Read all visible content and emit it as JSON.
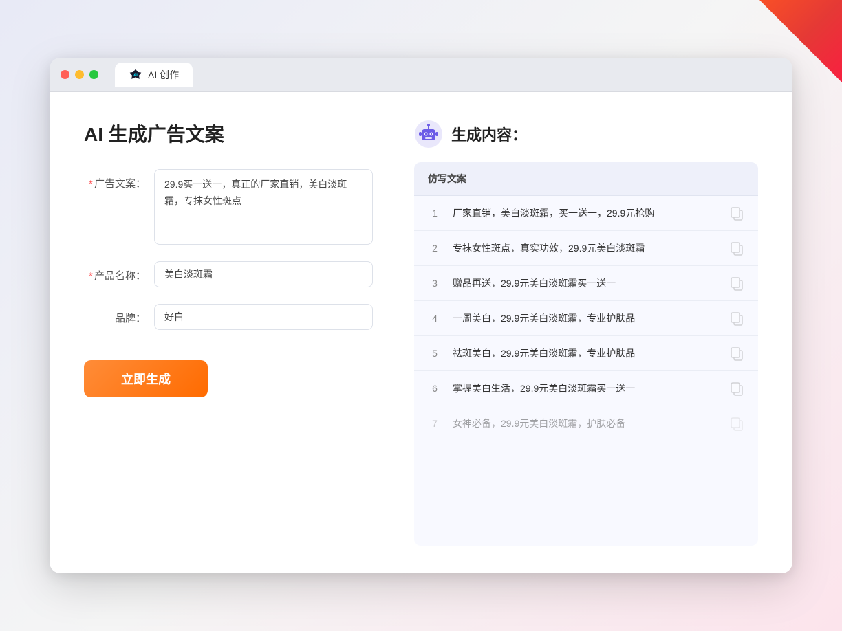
{
  "window": {
    "tab_title": "AI 创作"
  },
  "page": {
    "title": "AI 生成广告文案",
    "form": {
      "ad_copy_label": "广告文案：",
      "ad_copy_required": "*",
      "ad_copy_value": "29.9买一送一，真正的厂家直销，美白淡斑霜，专抹女性斑点",
      "product_name_label": "产品名称：",
      "product_name_required": "*",
      "product_name_value": "美白淡斑霜",
      "brand_label": "品牌：",
      "brand_value": "好白",
      "generate_btn_label": "立即生成"
    },
    "result": {
      "header_icon": "robot",
      "header_title": "生成内容：",
      "table_header": "仿写文案",
      "items": [
        {
          "num": "1",
          "text": "厂家直销，美白淡斑霜，买一送一，29.9元抢购"
        },
        {
          "num": "2",
          "text": "专抹女性斑点，真实功效，29.9元美白淡斑霜"
        },
        {
          "num": "3",
          "text": "赠品再送，29.9元美白淡斑霜买一送一"
        },
        {
          "num": "4",
          "text": "一周美白，29.9元美白淡斑霜，专业护肤品"
        },
        {
          "num": "5",
          "text": "祛斑美白，29.9元美白淡斑霜，专业护肤品"
        },
        {
          "num": "6",
          "text": "掌握美白生活，29.9元美白淡斑霜买一送一"
        },
        {
          "num": "7",
          "text": "女神必备，29.9元美白淡斑霜，护肤必备"
        }
      ]
    }
  },
  "colors": {
    "accent_orange": "#ff6b00",
    "required_red": "#ff4d4f",
    "text_primary": "#222222",
    "text_secondary": "#555555"
  }
}
